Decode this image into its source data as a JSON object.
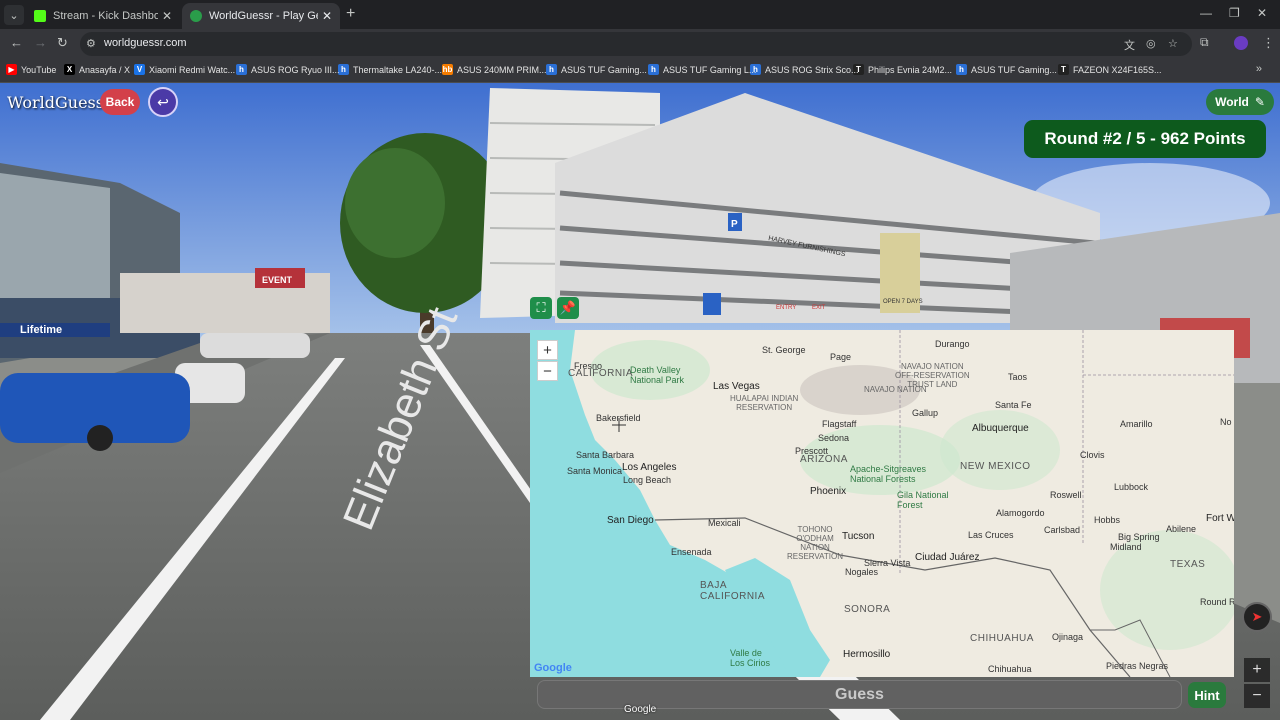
{
  "browser": {
    "tabs": [
      {
        "title": "Stream - Kick Dashboard",
        "favicon_color": "#53fc18",
        "active": false
      },
      {
        "title": "WorldGuessr - Play Geoguessr",
        "favicon_color": "#2a9d4a",
        "active": true
      }
    ],
    "url": "worldguessr.com",
    "bookmarks": [
      {
        "label": "YouTube",
        "icon_color": "#ff0000",
        "icon": "▶"
      },
      {
        "label": "Anasayfa / X",
        "icon_color": "#000000",
        "icon": "X"
      },
      {
        "label": "Xiaomi Redmi Watc...",
        "icon_color": "#1a73e8",
        "icon": "V"
      },
      {
        "label": "ASUS ROG Ryuo III...",
        "icon_color": "#2a6fd6",
        "icon": "h"
      },
      {
        "label": "Thermaltake LA240-...",
        "icon_color": "#2a6fd6",
        "icon": "h"
      },
      {
        "label": "ASUS 240MM PRIM...",
        "icon_color": "#f57c00",
        "icon": "hb"
      },
      {
        "label": "ASUS TUF Gaming...",
        "icon_color": "#2a6fd6",
        "icon": "h"
      },
      {
        "label": "ASUS TUF Gaming L...",
        "icon_color": "#2a6fd6",
        "icon": "h"
      },
      {
        "label": "ASUS ROG Strix Sco...",
        "icon_color": "#2a6fd6",
        "icon": "h"
      },
      {
        "label": "Philips Evnia 24M2...",
        "icon_color": "#222222",
        "icon": "T"
      },
      {
        "label": "ASUS TUF Gaming...",
        "icon_color": "#2a6fd6",
        "icon": "h"
      },
      {
        "label": "FAZEON X24F165S...",
        "icon_color": "#222222",
        "icon": "T"
      }
    ]
  },
  "game": {
    "title": "WorldGuessr",
    "back_label": "Back",
    "world_label": "World",
    "round_text": "Round #2 / 5 - 962 Points",
    "guess_label": "Guess",
    "hint_label": "Hint",
    "street_view_credit": "Google",
    "scene_signs": {
      "street": "Elizabeth St",
      "shop": "Lifetime",
      "event": "EVENT",
      "store": "HARVEY FURNISHINGS",
      "parking": "P",
      "open_sign": "OPEN 7 DAYS",
      "entry": "ENTRY",
      "exit": "EXIT"
    }
  },
  "map": {
    "credit": "Google",
    "labels": {
      "california": "CALIFORNIA",
      "fresno": "Fresno",
      "death_valley": "Death Valley\nNational Park",
      "st_george": "St. George",
      "page": "Page",
      "durango": "Durango",
      "navajo_nation_res": "NAVAJO NATION\nOFF-RESERVATION\nTRUST LAND",
      "las_vegas": "Las Vegas",
      "navajo_nation": "NAVAJO NATION",
      "taos": "Taos",
      "hualapai": "HUALAPAI INDIAN\nRESERVATION",
      "bakersfield": "Bakersfield",
      "santa_fe": "Santa Fe",
      "gallup": "Gallup",
      "flagstaff": "Flagstaff",
      "albuquerque": "Albuquerque",
      "amarillo": "Amarillo",
      "sedona": "Sedona",
      "santa_barbara": "Santa Barbara",
      "prescott": "Prescott",
      "arizona": "ARIZONA",
      "clovis": "Clovis",
      "new_mexico": "NEW MEXICO",
      "santa_monica": "Santa Monica",
      "los_angeles": "Los Angeles",
      "apache_sitgreaves": "Apache-Sitgreaves\nNational Forests",
      "long_beach": "Long Beach",
      "lubbock": "Lubbock",
      "roswell": "Roswell",
      "phoenix": "Phoenix",
      "gila": "Gila National\nForest",
      "alamogordo": "Alamogordo",
      "hobbs": "Hobbs",
      "san_diego": "San Diego",
      "mexicali": "Mexicali",
      "carlsbad": "Carlsbad",
      "fort_w": "Fort W",
      "abilene": "Abilene",
      "tohono": "TOHONO\nO'ODHAM\nNATION\nRESERVATION",
      "tucson": "Tucson",
      "las_cruces": "Las Cruces",
      "big_spring": "Big Spring",
      "midland": "Midland",
      "ensenada": "Ensenada",
      "ciudad_juarez": "Ciudad Juárez",
      "sierra_vista": "Sierra Vista",
      "texas": "TEXAS",
      "nogales": "Nogales",
      "baja_california": "BAJA\nCALIFORNIA",
      "round_r": "Round R",
      "sonora": "SONORA",
      "chihuahua_state": "CHIHUAHUA",
      "ojinaga": "Ojinaga",
      "valle_cirios": "Valle de\nLos Cirios",
      "hermosillo": "Hermosillo",
      "chihuahua_city": "Chihuahua",
      "piedras_negras": "Piedras Negras",
      "no": "No"
    }
  }
}
